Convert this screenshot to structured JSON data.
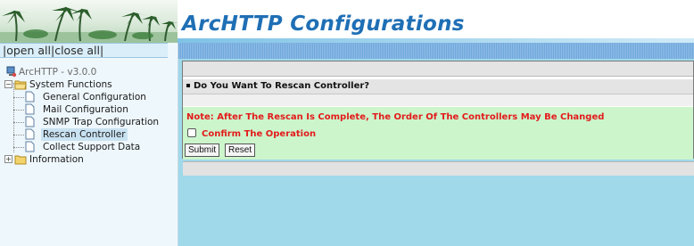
{
  "header": {
    "title": "ArcHTTP Configurations"
  },
  "nav": {
    "open_all": "|open all",
    "close_all": "|close all|",
    "root": "ArcHTTP - v3.0.0",
    "system_functions": "System Functions",
    "items": [
      {
        "label": "General Configuration"
      },
      {
        "label": "Mail Configuration"
      },
      {
        "label": "SNMP Trap Configuration"
      },
      {
        "label": "Rescan Controller"
      },
      {
        "label": "Collect Support Data"
      }
    ],
    "information": "Information",
    "selected": "Rescan Controller"
  },
  "form": {
    "title": "Do You Want To Rescan Controller?",
    "note": "Note: After The Rescan Is Complete, The Order Of The Controllers May Be Changed",
    "confirm_label": "Confirm The Operation",
    "confirm_checked": false,
    "submit_label": "Submit",
    "reset_label": "Reset"
  },
  "colors": {
    "title_blue": "#1f6fb5",
    "note_red": "#e31b1b",
    "form_green": "#ccf5cc",
    "main_bg": "#9fd9ea"
  }
}
